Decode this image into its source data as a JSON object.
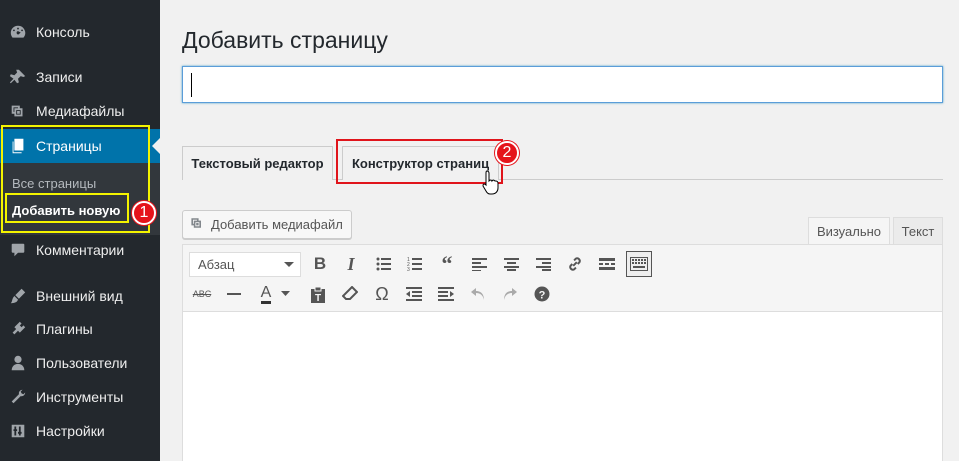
{
  "sidebar": {
    "items": [
      {
        "label": "Консоль",
        "icon": "dashboard-icon"
      },
      {
        "label": "Записи",
        "icon": "pin-icon"
      },
      {
        "label": "Медиафайлы",
        "icon": "media-icon"
      },
      {
        "label": "Страницы",
        "icon": "pages-icon"
      },
      {
        "label": "Комментарии",
        "icon": "comment-icon"
      },
      {
        "label": "Внешний вид",
        "icon": "brush-icon"
      },
      {
        "label": "Плагины",
        "icon": "plugin-icon"
      },
      {
        "label": "Пользователи",
        "icon": "user-icon"
      },
      {
        "label": "Инструменты",
        "icon": "wrench-icon"
      },
      {
        "label": "Настройки",
        "icon": "settings-icon"
      }
    ],
    "submenu": [
      "Все страницы",
      "Добавить новую"
    ],
    "active_color": "#0073aa"
  },
  "annotations": {
    "badge1": "1",
    "badge2": "2",
    "highlight_yellow": "#f4f400",
    "highlight_red": "#e0141b"
  },
  "main": {
    "page_title": "Добавить страницу",
    "title_input_value": "",
    "tabs": [
      "Текстовый редактор",
      "Конструктор страниц"
    ],
    "media_button": "Добавить медиафайл",
    "view_tabs": [
      "Визуально",
      "Текст"
    ],
    "format_select": "Абзац",
    "toolbar_row1": [
      "bold-icon",
      "italic-icon",
      "bullet-list-icon",
      "numbered-list-icon",
      "blockquote-icon",
      "align-left-icon",
      "align-center-icon",
      "align-right-icon",
      "link-icon",
      "read-more-icon",
      "toolbar-toggle-icon"
    ],
    "toolbar_row2": [
      "strikethrough-icon",
      "horizontal-line-icon",
      "text-color-icon",
      "paste-text-icon",
      "clear-formatting-icon",
      "special-character-icon",
      "outdent-icon",
      "indent-icon",
      "undo-icon",
      "redo-icon",
      "help-icon"
    ]
  }
}
